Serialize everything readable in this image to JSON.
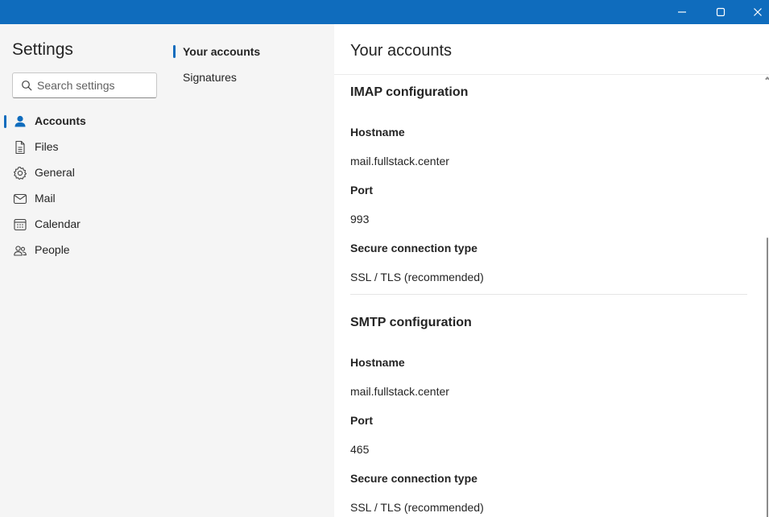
{
  "titlebar": {
    "accent": "#0f6cbd",
    "controls": [
      "minimize-icon",
      "maximize-icon",
      "close-icon"
    ]
  },
  "sidebar": {
    "title": "Settings",
    "search": {
      "placeholder": "Search settings",
      "value": ""
    },
    "items": [
      {
        "label": "Accounts",
        "icon": "person-icon",
        "active": true
      },
      {
        "label": "Files",
        "icon": "document-icon",
        "active": false
      },
      {
        "label": "General",
        "icon": "gear-icon",
        "active": false
      },
      {
        "label": "Mail",
        "icon": "envelope-icon",
        "active": false
      },
      {
        "label": "Calendar",
        "icon": "calendar-icon",
        "active": false
      },
      {
        "label": "People",
        "icon": "people-icon",
        "active": false
      }
    ]
  },
  "subnav": {
    "items": [
      {
        "label": "Your accounts",
        "active": true
      },
      {
        "label": "Signatures",
        "active": false
      }
    ]
  },
  "main": {
    "title": "Your accounts",
    "imap": {
      "title": "IMAP configuration",
      "hostname_label": "Hostname",
      "hostname": "mail.fullstack.center",
      "port_label": "Port",
      "port": "993",
      "security_label": "Secure connection type",
      "security": "SSL / TLS (recommended)"
    },
    "smtp": {
      "title": "SMTP configuration",
      "hostname_label": "Hostname",
      "hostname": "mail.fullstack.center",
      "port_label": "Port",
      "port": "465",
      "security_label": "Secure connection type",
      "security": "SSL / TLS (recommended)"
    }
  }
}
